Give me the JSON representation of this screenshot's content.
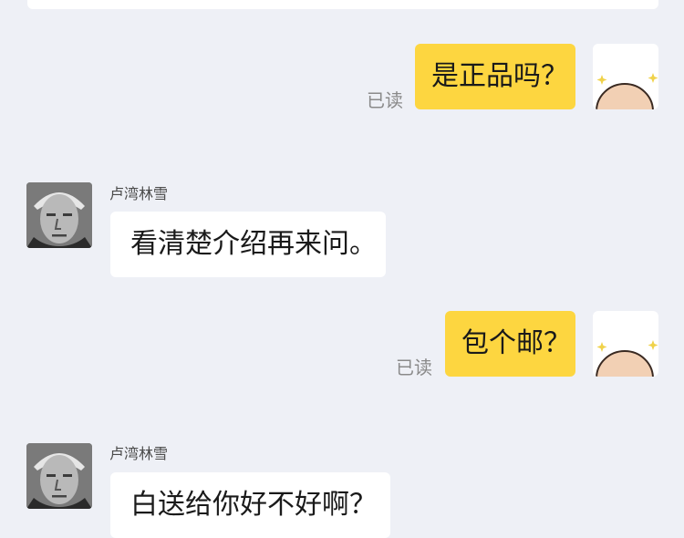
{
  "messages": [
    {
      "from": "me",
      "text": "是正品吗？",
      "status": "已读"
    },
    {
      "from": "other",
      "sender": "卢湾林雪",
      "text": "看清楚介绍再来问。"
    },
    {
      "from": "me",
      "text": "包个邮？",
      "status": "已读"
    },
    {
      "from": "other",
      "sender": "卢湾林雪",
      "text": "白送给你好不好啊？"
    }
  ],
  "colors": {
    "background": "#eef0f6",
    "my_bubble": "#fdd640",
    "other_bubble": "#ffffff",
    "read_status": "#8a8a8a"
  },
  "icons": {
    "my_avatar": "bald-head-avatar-icon",
    "other_avatar": "elderly-man-photo-avatar"
  }
}
